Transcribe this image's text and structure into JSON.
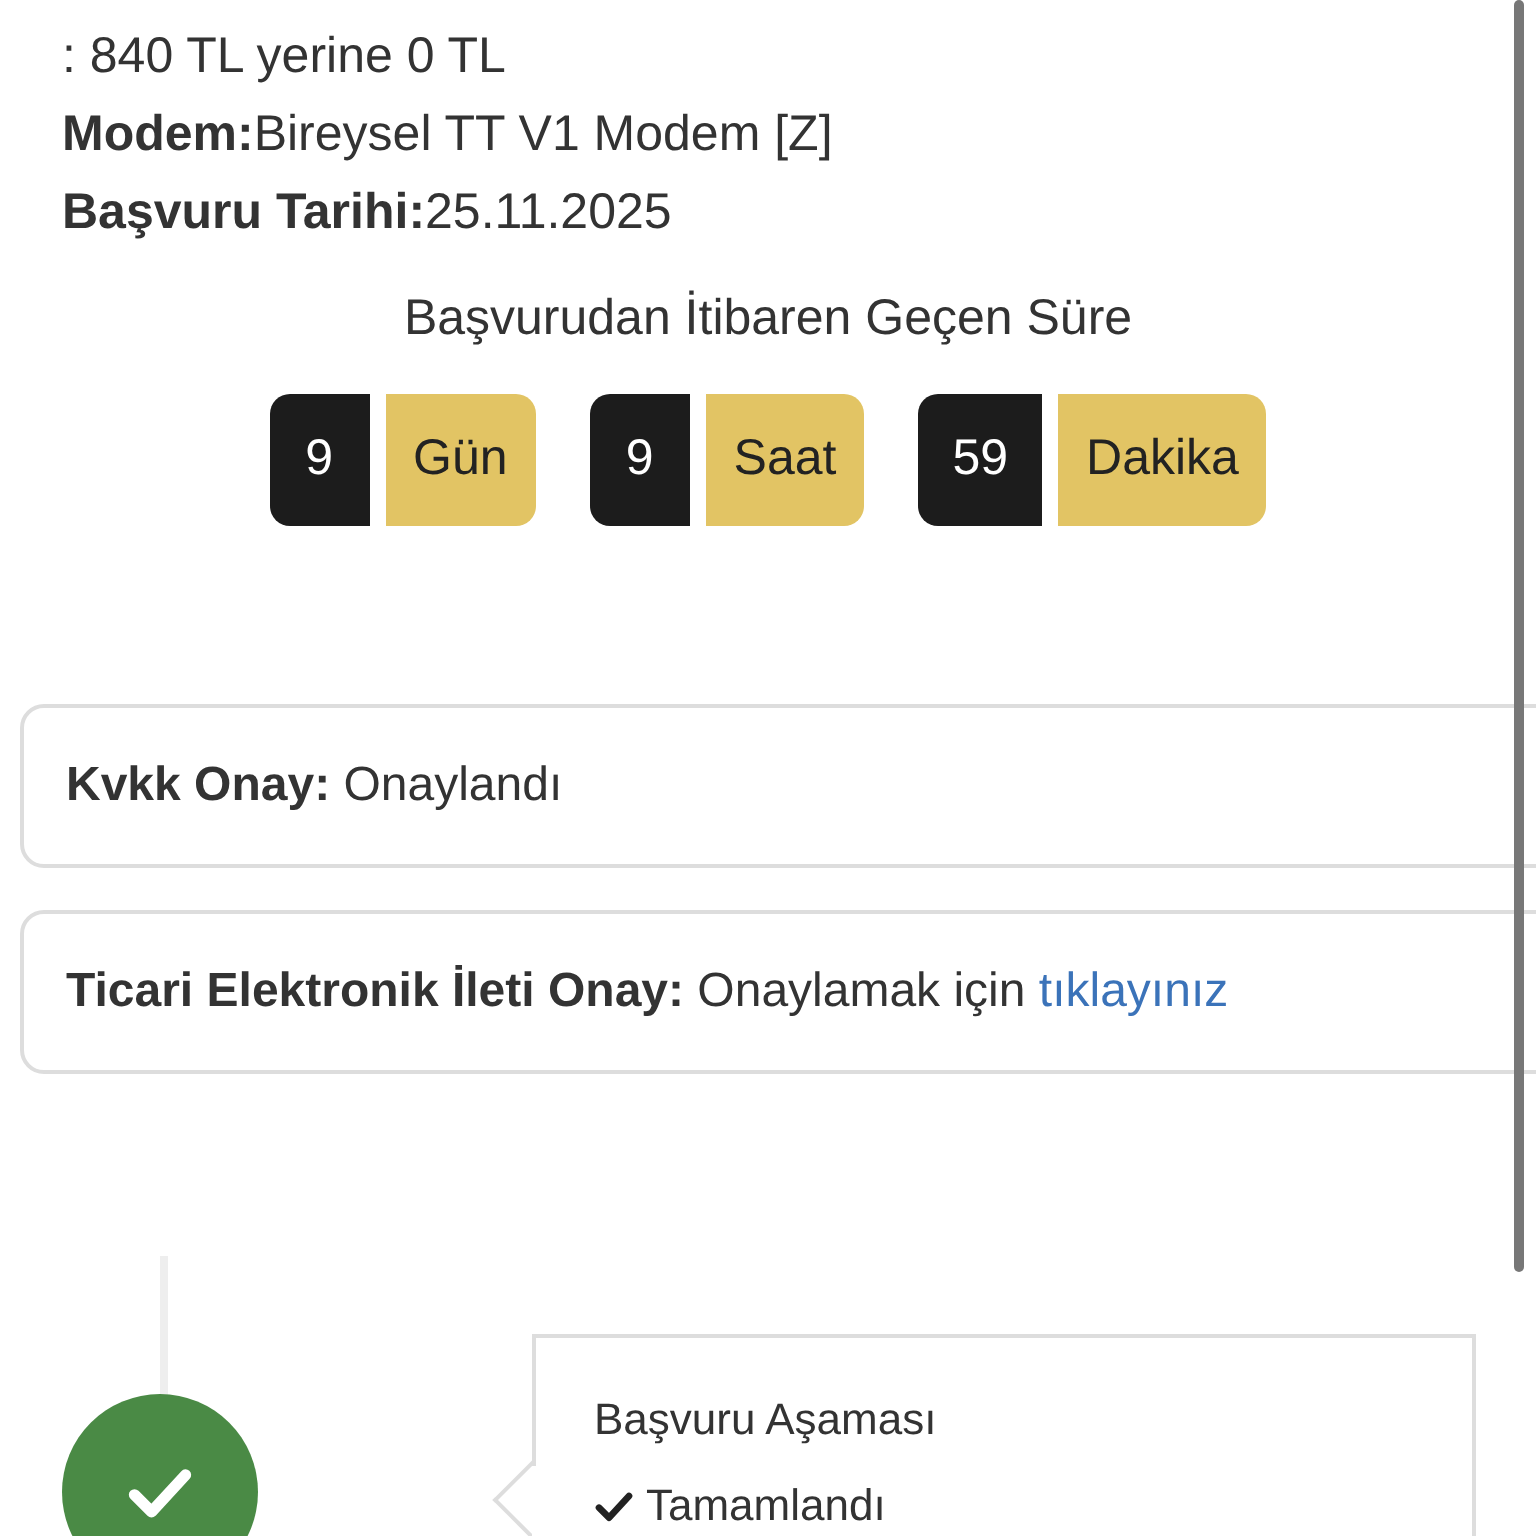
{
  "details_continuation": ": 840 TL yerine 0 TL",
  "details": [
    {
      "label": "Modem:",
      "value": "Bireysel TT V1 Modem [Z]"
    },
    {
      "label": "Başvuru Tarihi:",
      "value": "25.11.2025"
    }
  ],
  "elapsed": {
    "title": "Başvurudan İtibaren Geçen Süre",
    "units": [
      {
        "value": "9",
        "unit": "Gün"
      },
      {
        "value": "9",
        "unit": "Saat"
      },
      {
        "value": "59",
        "unit": "Dakika"
      }
    ]
  },
  "consents": [
    {
      "label": "Kvkk Onay:",
      "value": "Onaylandı"
    },
    {
      "label": "Ticari Elektronik İleti Onay:",
      "value": "Onaylamak için",
      "link": "tıklayınız"
    }
  ],
  "timeline": [
    {
      "title": "Başvuru Aşaması",
      "status": "Tamamlandı",
      "completed": true
    }
  ]
}
